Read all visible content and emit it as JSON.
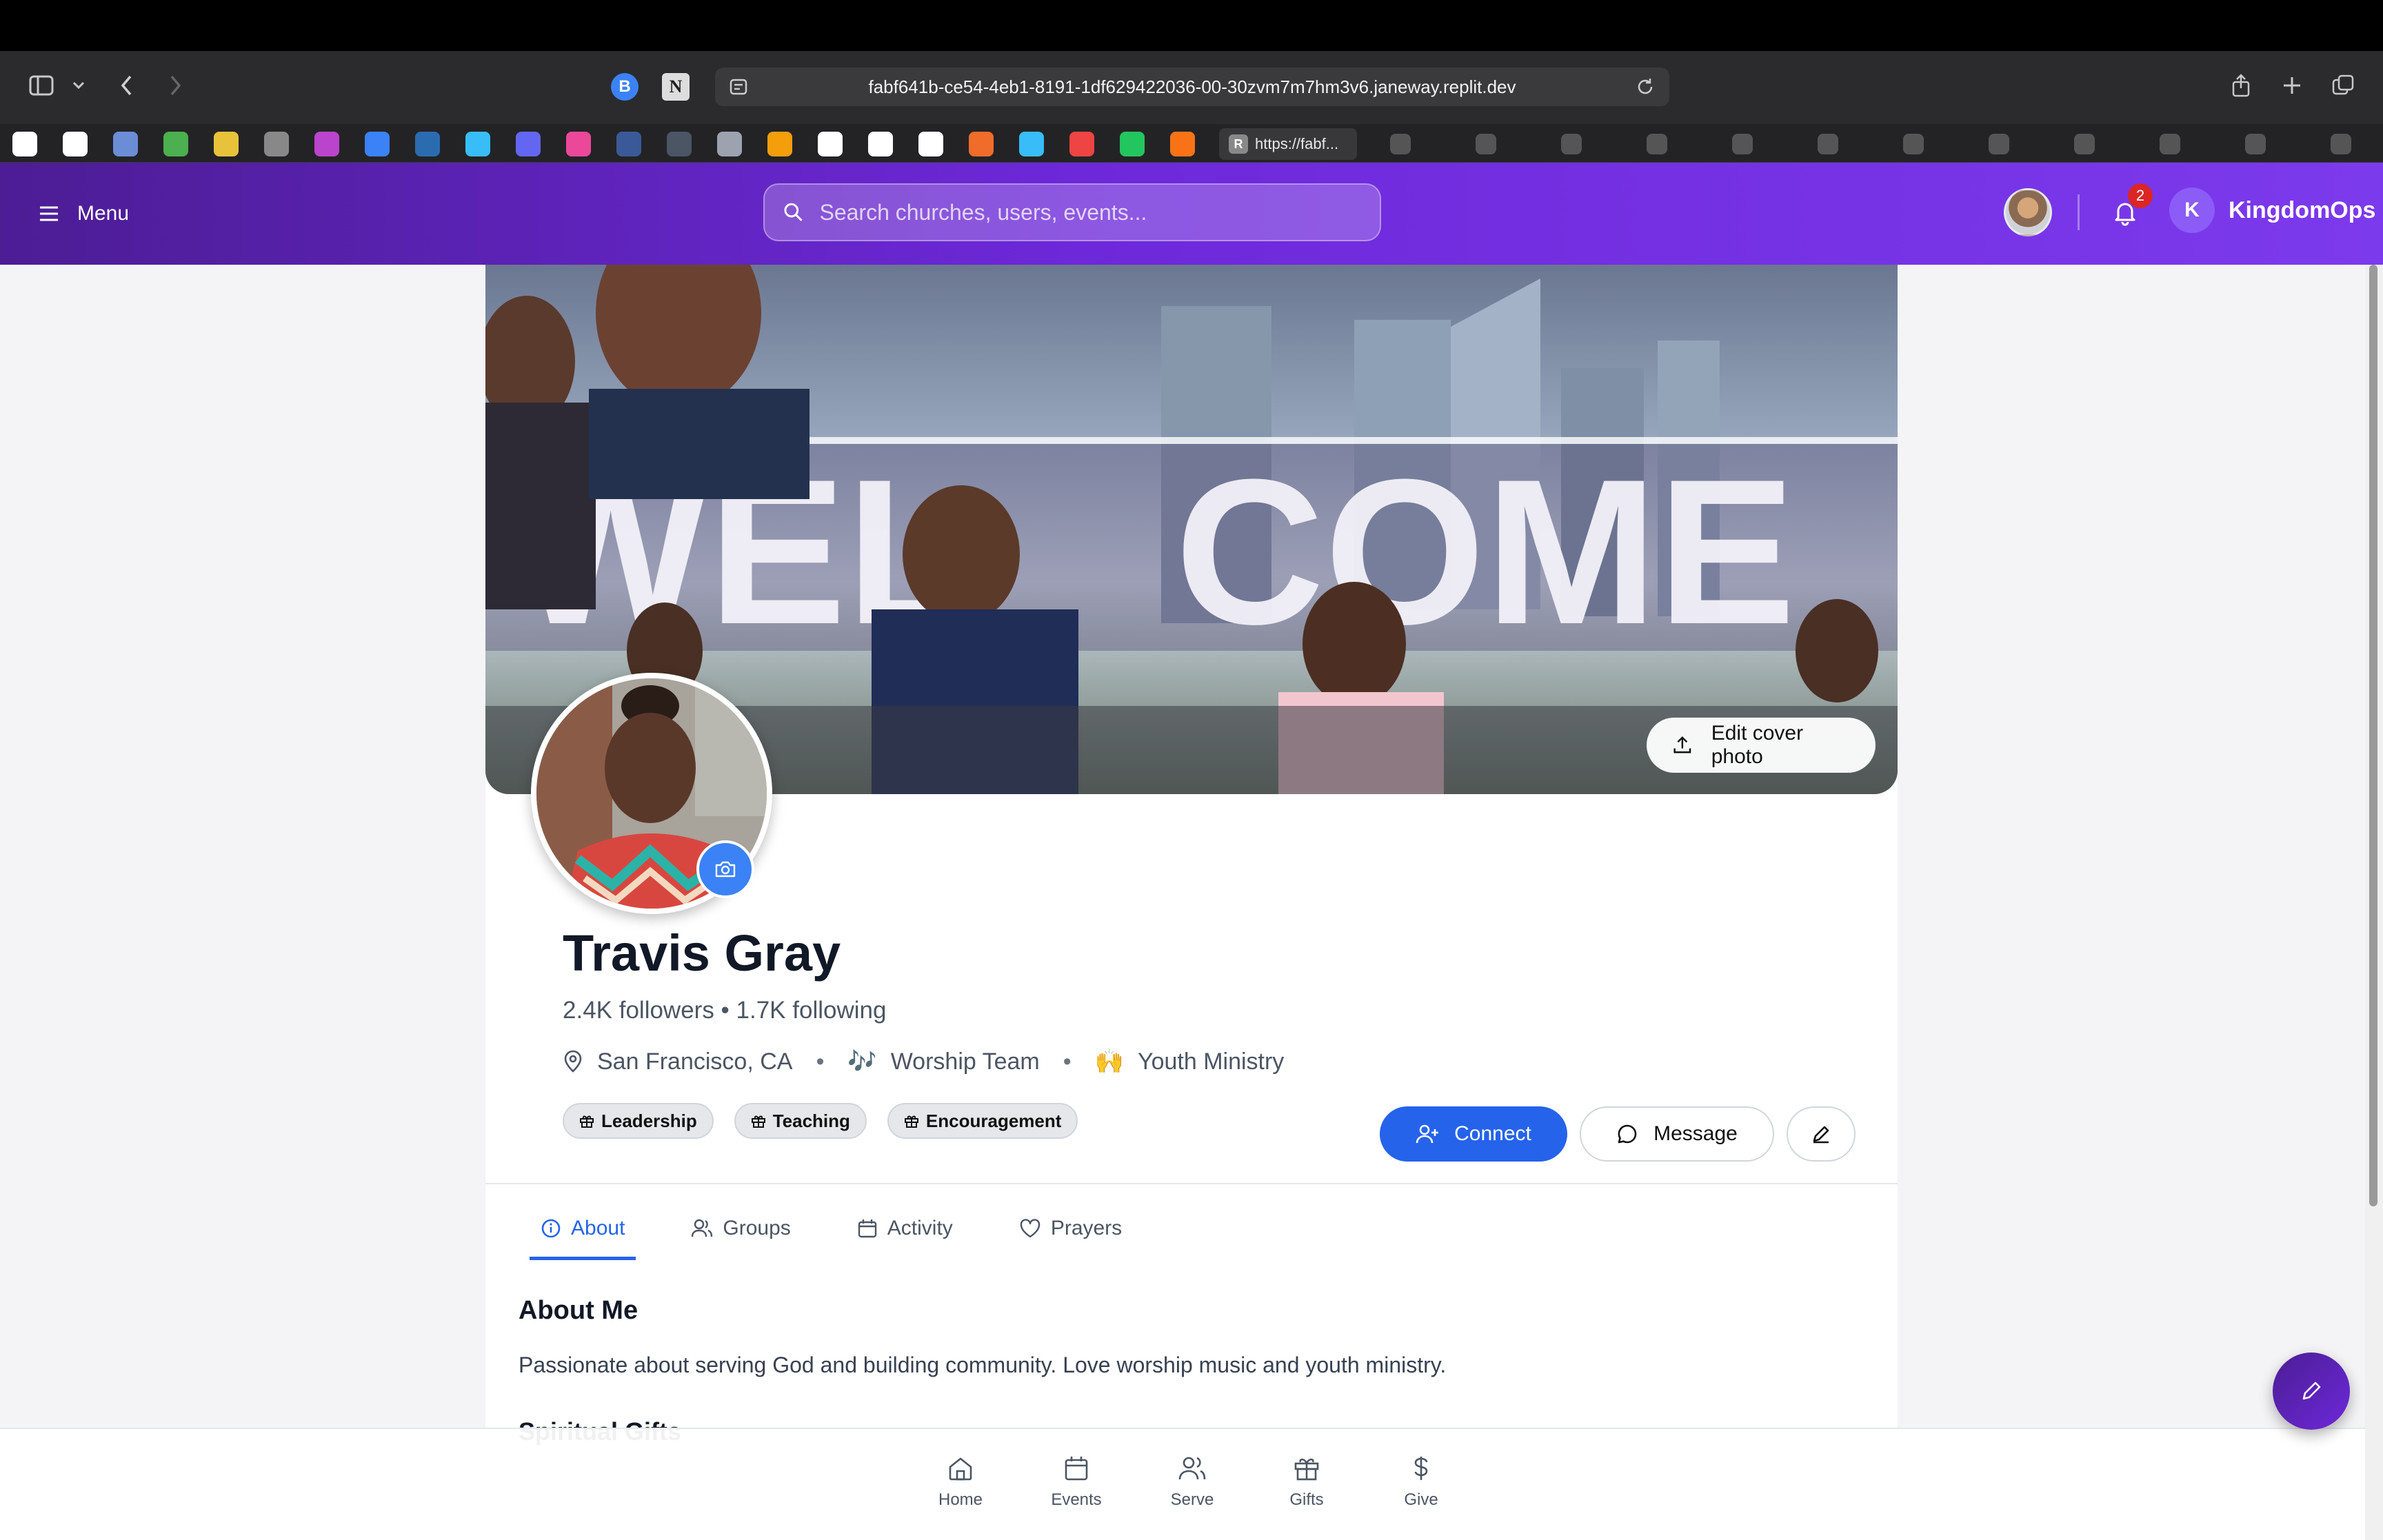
{
  "browser": {
    "url": "fabf641b-ce54-4eb1-8191-1df629422036-00-30zvm7m7hm3v6.janeway.replit.dev",
    "active_tab_label": "https://fabf...",
    "bookmark_colors": [
      "#ffffff",
      "#ffffff",
      "#6b8dd6",
      "#4caf50",
      "#e8c23a",
      "#888888",
      "#bb44cc",
      "#3b82f6",
      "#2b6cb0",
      "#38bdf8",
      "#6366f1",
      "#ec4899",
      "#3b5998",
      "#4b5563",
      "#9ca3af",
      "#f59e0b",
      "#ffffff",
      "#ffffff",
      "#ffffff",
      "#ef6c2a",
      "#38bdf8",
      "#ef4444",
      "#22c55e",
      "#f97316"
    ],
    "tab_icons": [
      "R",
      "R",
      "openai-icon",
      "orange-icon",
      "F1",
      "grid-icon",
      "K",
      "web-icon",
      "web-icon",
      "react-icon",
      "red-icon",
      "red-icon",
      "google-icon"
    ]
  },
  "header": {
    "menu_label": "Menu",
    "search_placeholder": "Search churches, users, events...",
    "notification_count": "2",
    "brand_initial": "K",
    "brand_name": "KingdomOps"
  },
  "profile": {
    "edit_cover_label": "Edit cover photo",
    "name": "Travis Gray",
    "followers_line": "2.4K followers • 1.7K following",
    "location": "San Francisco, CA",
    "team_emoji": "🎶",
    "team": "Worship Team",
    "ministry_emoji": "🙌",
    "ministry": "Youth Ministry",
    "tags": [
      "Leadership",
      "Teaching",
      "Encouragement"
    ],
    "connect_label": "Connect",
    "message_label": "Message"
  },
  "tabs": [
    {
      "label": "About",
      "icon": "info-icon"
    },
    {
      "label": "Groups",
      "icon": "users-icon"
    },
    {
      "label": "Activity",
      "icon": "calendar-icon"
    },
    {
      "label": "Prayers",
      "icon": "heart-icon"
    }
  ],
  "about": {
    "title": "About Me",
    "text": "Passionate about serving God and building community. Love worship music and youth ministry.",
    "next_section_peek": "Spiritual Gifts"
  },
  "bottom_nav": [
    {
      "label": "Home",
      "icon": "home-icon"
    },
    {
      "label": "Events",
      "icon": "calendar-icon"
    },
    {
      "label": "Serve",
      "icon": "users-icon"
    },
    {
      "label": "Gifts",
      "icon": "gift-icon"
    },
    {
      "label": "Give",
      "icon": "dollar-icon"
    }
  ],
  "colors": {
    "brand_purple": "#6d28d9",
    "primary_blue": "#2563eb",
    "badge_red": "#dc2626"
  }
}
